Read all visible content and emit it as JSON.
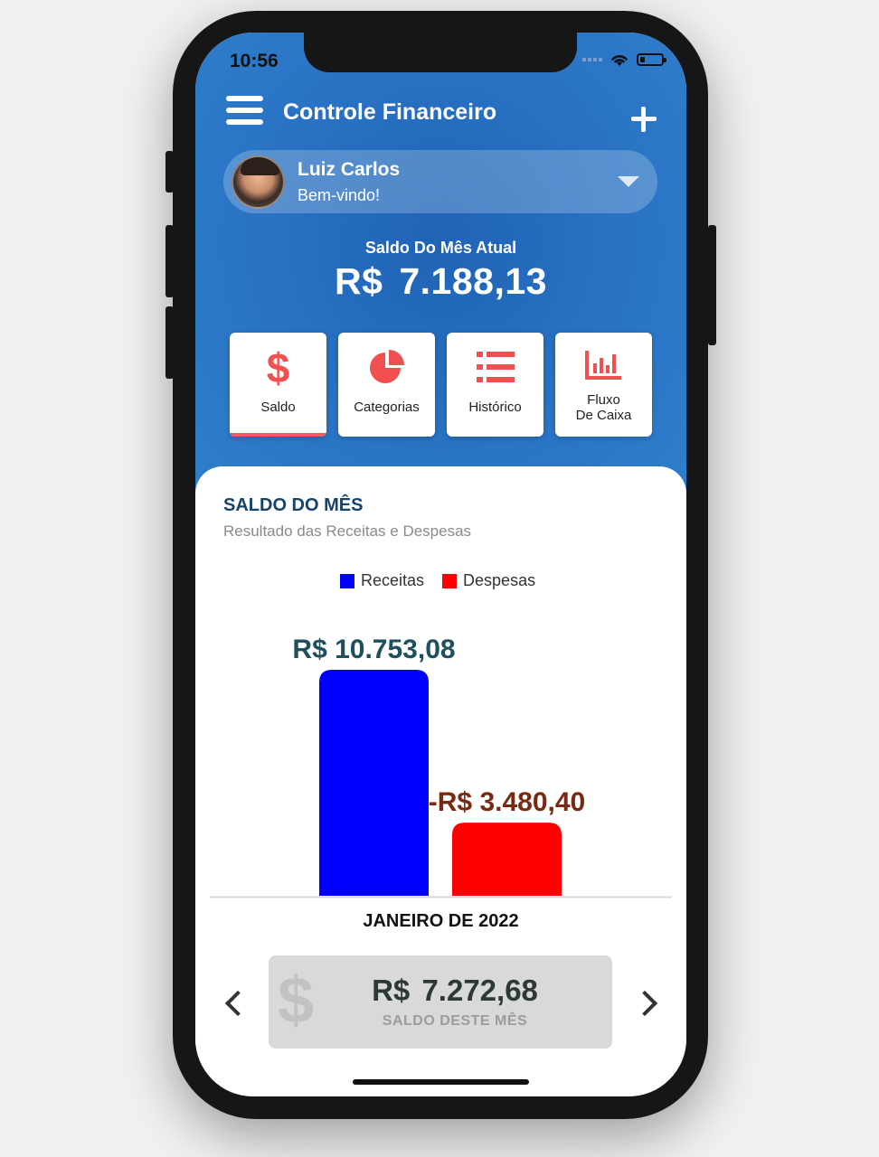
{
  "status_bar": {
    "time": "10:56"
  },
  "header": {
    "title": "Controle Financeiro"
  },
  "user": {
    "name": "Luiz Carlos",
    "greeting": "Bem-vindo!"
  },
  "balance": {
    "label": "Saldo Do Mês Atual",
    "value": "R$  7.188,13"
  },
  "tiles": [
    {
      "label": "Saldo",
      "icon": "dollar-icon",
      "active": true
    },
    {
      "label": "Categorias",
      "icon": "pie-chart-icon",
      "active": false
    },
    {
      "label": "Histórico",
      "icon": "list-icon",
      "active": false
    },
    {
      "label_line1": "Fluxo",
      "label_line2": "De Caixa",
      "icon": "bar-chart-icon",
      "active": false
    }
  ],
  "colors": {
    "accent": "#f05050",
    "header_blue": "#2a73c4",
    "receitas": "#0000ff",
    "despesas": "#ff0000"
  },
  "card": {
    "title": "SALDO DO MÊS",
    "subtitle": "Resultado das Receitas e Despesas"
  },
  "chart_data": {
    "type": "bar",
    "categories": [
      "JANEIRO DE 2022"
    ],
    "series": [
      {
        "name": "Receitas",
        "values": [
          10753.08
        ],
        "label": "R$  10.753,08",
        "color": "#0000ff",
        "label_color": "#1d4f5e"
      },
      {
        "name": "Despesas",
        "values": [
          -3480.4
        ],
        "label": "-R$  3.480,40",
        "color": "#ff0000",
        "label_color": "#7a2a12"
      }
    ],
    "legend_position": "top-center",
    "grid": false
  },
  "summary": {
    "value": "R$  7.272,68",
    "label": "SALDO DESTE MÊS"
  }
}
